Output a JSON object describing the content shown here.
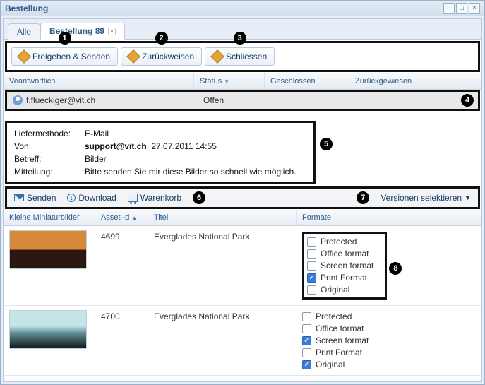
{
  "title": "Bestellung",
  "tabs": {
    "all": "Alle",
    "order": "Bestellung 89"
  },
  "toolbar": {
    "release": "Freigeben & Senden",
    "reject": "Zurückweisen",
    "close": "Schliessen"
  },
  "columns": {
    "responsible": "Veantwortlich",
    "status": "Status",
    "closed": "Geschlossen",
    "rejected": "Zurückgewiesen"
  },
  "status_row": {
    "responsible": "f.flueckiger@vit.ch",
    "status": "Offen"
  },
  "details": {
    "method_label": "Liefermethode:",
    "method_val": "E-Mail",
    "from_label": "Von:",
    "from_val_bold": "support@vit.ch",
    "from_val_rest": ", 27.07.2011 14:55",
    "subject_label": "Betreff:",
    "subject_val": "Bilder",
    "message_label": "Mitteilung:",
    "message_val": "Bitte senden Sie mir diese Bilder so schnell wie möglich."
  },
  "actions": {
    "send": "Senden",
    "download": "Download",
    "cart": "Warenkorb",
    "versions": "Versionen selektieren"
  },
  "grid_cols": {
    "thumb": "Kleine Miniaturbilder",
    "asset": "Asset-Id",
    "title": "Titel",
    "format": "Formate"
  },
  "formats": [
    "Protected",
    "Office format",
    "Screen format",
    "Print Format",
    "Original"
  ],
  "assets": [
    {
      "id": "4699",
      "title": "Everglades National Park",
      "thumb": "sunset",
      "checked": [
        false,
        false,
        false,
        true,
        false
      ],
      "boxed": true
    },
    {
      "id": "4700",
      "title": "Everglades National Park",
      "thumb": "sky",
      "checked": [
        false,
        false,
        true,
        false,
        true
      ],
      "boxed": false
    }
  ],
  "callouts": {
    "c1": "1",
    "c2": "2",
    "c3": "3",
    "c4": "4",
    "c5": "5",
    "c6": "6",
    "c7": "7",
    "c8": "8"
  }
}
